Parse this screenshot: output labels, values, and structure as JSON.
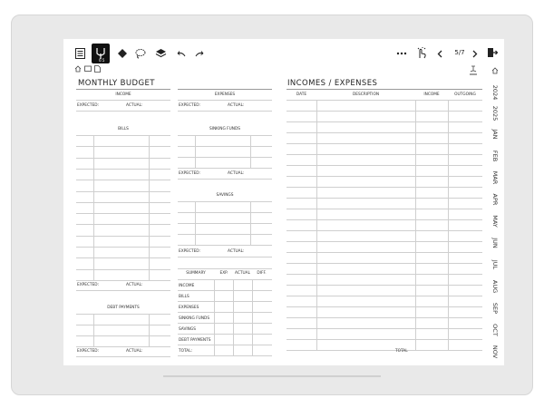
{
  "toolbar": {
    "pen_badge": "0.5",
    "page_indicator": "5/7",
    "icons": [
      "menu-icon",
      "pen-icon",
      "eraser-icon",
      "lasso-icon",
      "layers-icon",
      "undo-icon",
      "redo-icon",
      "more-icon",
      "touch-toggle-icon",
      "prev-page-icon",
      "next-page-icon",
      "exit-icon",
      "home-icon",
      "folder-icon",
      "document-icon",
      "text-tool-icon"
    ]
  },
  "left": {
    "title": "MONTHLY BUDGET",
    "income": {
      "header": "INCOME",
      "expected": "EXPECTED:",
      "actual": "ACTUAL:"
    },
    "expenses": {
      "header": "EXPENSES",
      "expected": "EXPECTED:",
      "actual": "ACTUAL:"
    },
    "bills": {
      "header": "BILLS",
      "expected": "EXPECTED:",
      "actual": "ACTUAL:"
    },
    "sinking": {
      "header": "SINKING FUNDS",
      "expected": "EXPECTED:",
      "actual": "ACTUAL:"
    },
    "savings": {
      "header": "SAVINGS",
      "expected": "EXPECTED:",
      "actual": "ACTUAL:"
    },
    "debt": {
      "header": "DEBT PAYMENTS",
      "expected": "EXPECTED:",
      "actual": "ACTUAL:"
    },
    "summary": {
      "header": "SUMMARY",
      "cols": [
        "EXP.",
        "ACTUAL",
        "DIFF."
      ],
      "rows": [
        "INCOME",
        "BILLS",
        "EXPENSES",
        "SINKING FUNDS",
        "SAVINGS",
        "DEBT PAYMENTS",
        "TOTAL:"
      ]
    }
  },
  "right": {
    "title": "INCOMES / EXPENSES",
    "columns": [
      "DATE",
      "DESCRIPTION",
      "INCOME",
      "OUTGOING"
    ],
    "total": "TOTAL"
  },
  "tabs": [
    "2024",
    "2025",
    "JAN",
    "FEB",
    "MAR",
    "APR",
    "MAY",
    "JUN",
    "JUL",
    "AUG",
    "SEP",
    "OCT",
    "NOV"
  ]
}
